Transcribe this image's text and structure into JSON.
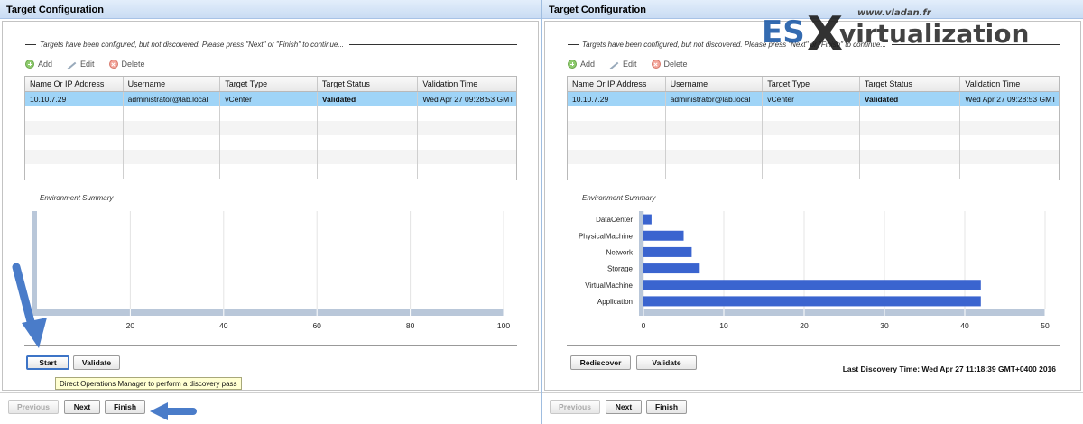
{
  "left": {
    "title": "Target Configuration",
    "targets_legend": "Targets have been configured, but not discovered. Please press \"Next\" or \"Finish\" to continue...",
    "toolbar": {
      "add": "Add",
      "edit": "Edit",
      "delete": "Delete"
    },
    "columns": [
      "Name Or IP Address",
      "Username",
      "Target Type",
      "Target Status",
      "Validation Time"
    ],
    "rows": [
      [
        "10.10.7.29",
        "administrator@lab.local",
        "vCenter",
        "Validated",
        "Wed Apr 27 09:28:53 GMT"
      ]
    ],
    "env_legend": "Environment Summary",
    "buttons": {
      "start": "Start",
      "validate": "Validate"
    },
    "tooltip": "Direct Operations Manager to perform a discovery pass",
    "nav": {
      "previous": "Previous",
      "next": "Next",
      "finish": "Finish"
    }
  },
  "right": {
    "title": "Target Configuration",
    "targets_legend": "Targets have been configured, but not discovered. Please press \"Next\" or \"Finish\" to continue...",
    "toolbar": {
      "add": "Add",
      "edit": "Edit",
      "delete": "Delete"
    },
    "columns": [
      "Name Or IP Address",
      "Username",
      "Target Type",
      "Target Status",
      "Validation Time"
    ],
    "rows": [
      [
        "10.10.7.29",
        "administrator@lab.local",
        "vCenter",
        "Validated",
        "Wed Apr 27 09:28:53 GMT"
      ]
    ],
    "env_legend": "Environment Summary",
    "buttons": {
      "rediscover": "Rediscover",
      "validate": "Validate"
    },
    "last_discovery": "Last Discovery Time: Wed Apr 27 11:18:39 GMT+0400 2016",
    "nav": {
      "previous": "Previous",
      "next": "Next",
      "finish": "Finish"
    }
  },
  "watermark": {
    "brand_es": "ES",
    "brand_x": "X",
    "brand_rest": "virtualization",
    "url": "www.vladan.fr"
  },
  "colors": {
    "bar": "#3a64cf",
    "track": "#b9c7d9",
    "selected_row": "#9fd4f7",
    "arrow": "#4a7cc9"
  },
  "chart_data": [
    {
      "type": "bar",
      "orientation": "horizontal",
      "categories": [],
      "values": [],
      "xticks": [
        20,
        40,
        60,
        80,
        100
      ],
      "xlim": [
        0,
        100
      ]
    },
    {
      "type": "bar",
      "orientation": "horizontal",
      "categories": [
        "DataCenter",
        "PhysicalMachine",
        "Network",
        "Storage",
        "VirtualMachine",
        "Application"
      ],
      "values": [
        1,
        5,
        6,
        7,
        42,
        42
      ],
      "xticks": [
        0,
        10,
        20,
        30,
        40,
        50
      ],
      "xlim": [
        0,
        50
      ]
    }
  ]
}
